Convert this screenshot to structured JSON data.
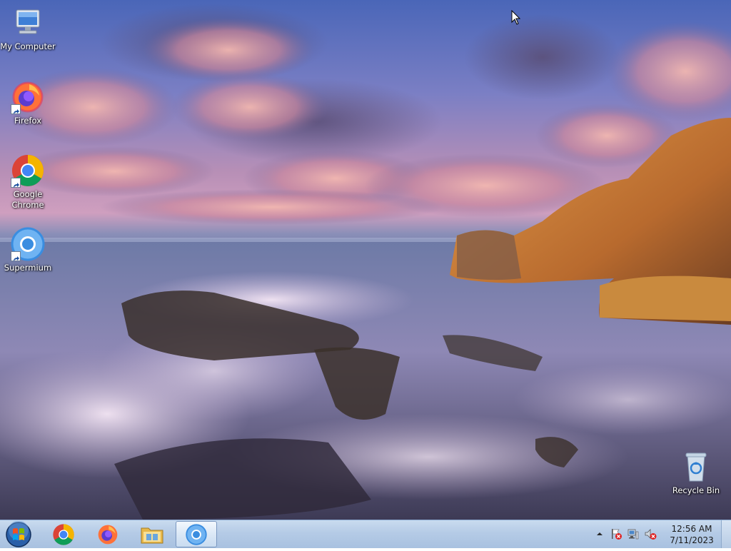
{
  "desktop": {
    "icons": [
      {
        "label": "My Computer",
        "icon": "computer-icon"
      },
      {
        "label": "Firefox",
        "icon": "firefox-icon"
      },
      {
        "label": "Google Chrome",
        "icon": "chrome-icon"
      },
      {
        "label": "Supermium",
        "icon": "supermium-icon"
      },
      {
        "label": "Recycle Bin",
        "icon": "recycle-bin-icon"
      }
    ]
  },
  "taskbar": {
    "start_icon": "windows-start-icon",
    "pinned": [
      {
        "name": "chrome",
        "icon": "chrome-icon"
      },
      {
        "name": "firefox",
        "icon": "firefox-icon"
      },
      {
        "name": "file-explorer",
        "icon": "folder-icon"
      },
      {
        "name": "supermium",
        "icon": "supermium-icon",
        "active": true
      }
    ],
    "tray": {
      "icons": [
        "show-hidden-icons-chevron",
        "action-center-flag-icon",
        "network-icon",
        "volume-muted-icon"
      ],
      "time": "12:56 AM",
      "date": "7/11/2023"
    }
  },
  "colors": {
    "taskbar": "#b5cbe6",
    "chrome_red": "#db4437",
    "chrome_green": "#0f9d58",
    "chrome_yellow": "#f4b400",
    "chrome_blue": "#4285f4",
    "supermium_blue": "#3a8de0",
    "firefox_orange": "#ff7139"
  }
}
